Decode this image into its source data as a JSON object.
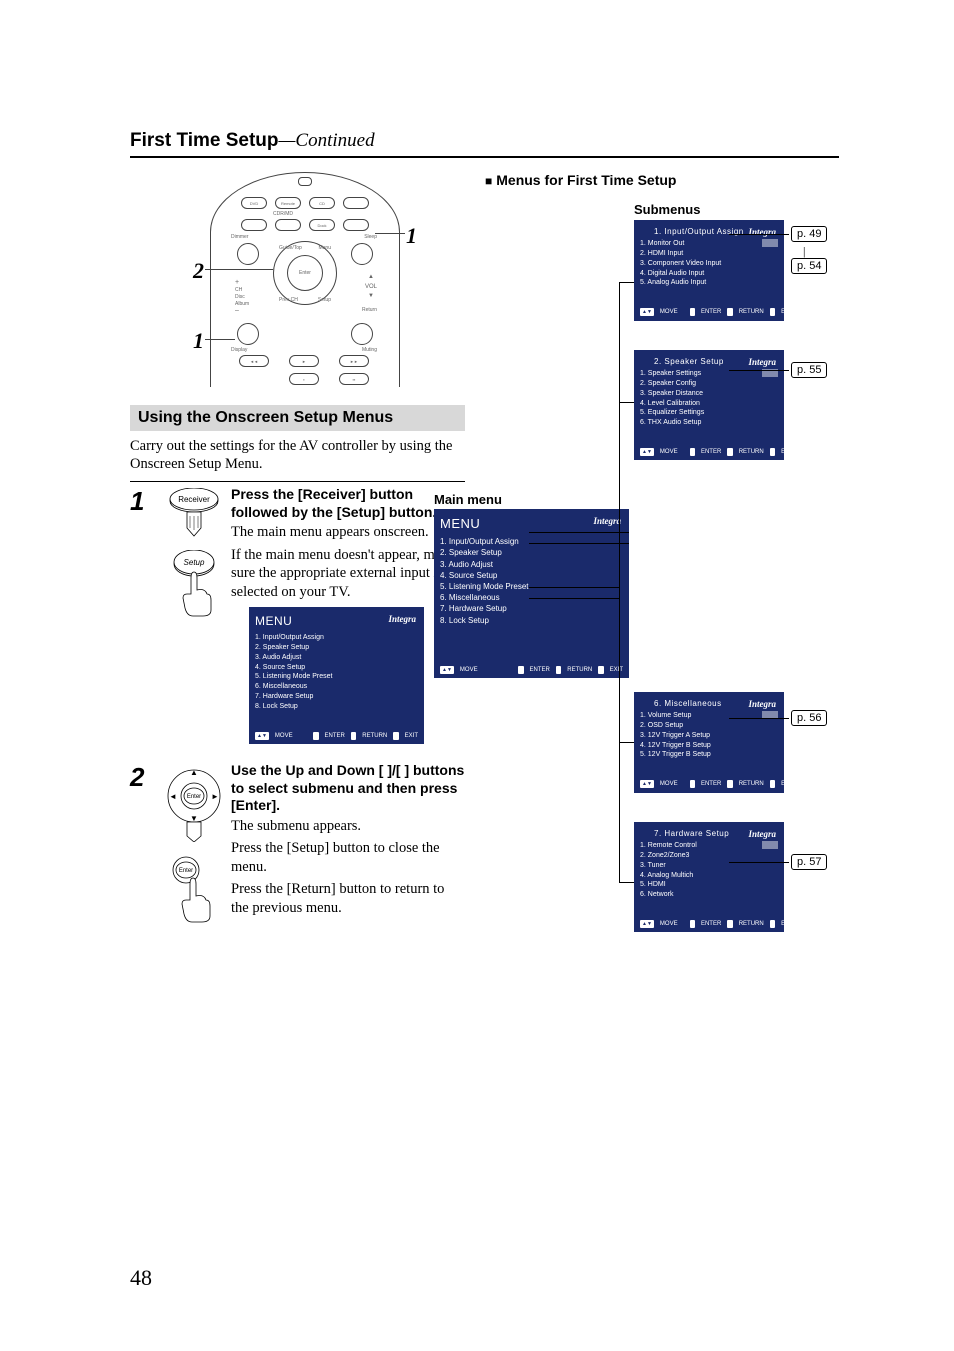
{
  "page_number": "48",
  "header": {
    "title": "First Time Setup",
    "continued": "—Continued"
  },
  "diagram": {
    "labels": {
      "top_right": "1",
      "mid_left": "2",
      "bottom_left": "1"
    }
  },
  "section": {
    "heading": "Using the Onscreen Setup Menus",
    "intro": "Carry out the settings for the AV controller by using the Onscreen Setup Menu."
  },
  "steps": [
    {
      "num": "1",
      "bold": "Press the [Receiver] button followed by the [Setup] button.",
      "body": [
        "The main menu appears onscreen.",
        "If the main menu doesn't appear, make sure the appropriate external input is selected on your TV."
      ],
      "btn_top": "Receiver",
      "btn_bot": "Setup"
    },
    {
      "num": "2",
      "bold": "Use the Up and Down [   ]/[   ] buttons to select submenu and then press [Enter].",
      "body": [
        "The submenu appears.",
        "Press the [Setup] button to close the menu.",
        "Press the [Return] button to return to the previous menu."
      ],
      "btn_top": "Enter",
      "btn_bot": "Enter"
    }
  ],
  "osd_main": {
    "title": "MENU",
    "brand": "Integra",
    "items": [
      "1. Input/Output Assign",
      "2. Speaker Setup",
      "3. Audio Adjust",
      "4. Source Setup",
      "5. Listening Mode Preset",
      "6. Miscellaneous",
      "7. Hardware Setup",
      "8. Lock Setup"
    ],
    "footer": {
      "move": "MOVE",
      "enter": "ENTER",
      "return": "RETURN",
      "exit": "EXIT"
    }
  },
  "right": {
    "heading": "Menus for First Time Setup",
    "submenus_label": "Submenus",
    "mainmenu_label": "Main menu",
    "pagerefs": {
      "p49": "p. 49",
      "p54": "p. 54",
      "p55": "p. 55",
      "p56": "p. 56",
      "p57": "p. 57"
    },
    "subs": [
      {
        "title": "1.    Input/Output Assign",
        "items": [
          "1.    Monitor Out",
          "2.    HDMI Input",
          "3.    Component Video Input",
          "4.    Digital Audio Input",
          "5.    Analog Audio Input"
        ]
      },
      {
        "title": "2.    Speaker Setup",
        "items": [
          "1.    Speaker Settings",
          "2.    Speaker Config",
          "3.    Speaker Distance",
          "4.    Level Calibration",
          "5.    Equalizer Settings",
          "6.    THX Audio Setup"
        ]
      },
      {
        "title": "6.    Miscellaneous",
        "items": [
          "1.    Volume Setup",
          "2.    OSD Setup",
          "3.    12V Trigger A Setup",
          "4.    12V Trigger B Setup",
          "5.    12V Trigger B Setup"
        ]
      },
      {
        "title": "7.    Hardware Setup",
        "items": [
          "1.    Remote Control",
          "2.    Zone2/Zone3",
          "3.    Tuner",
          "4.    Analog Multich",
          "5.    HDMI",
          "6.    Network"
        ]
      }
    ]
  }
}
